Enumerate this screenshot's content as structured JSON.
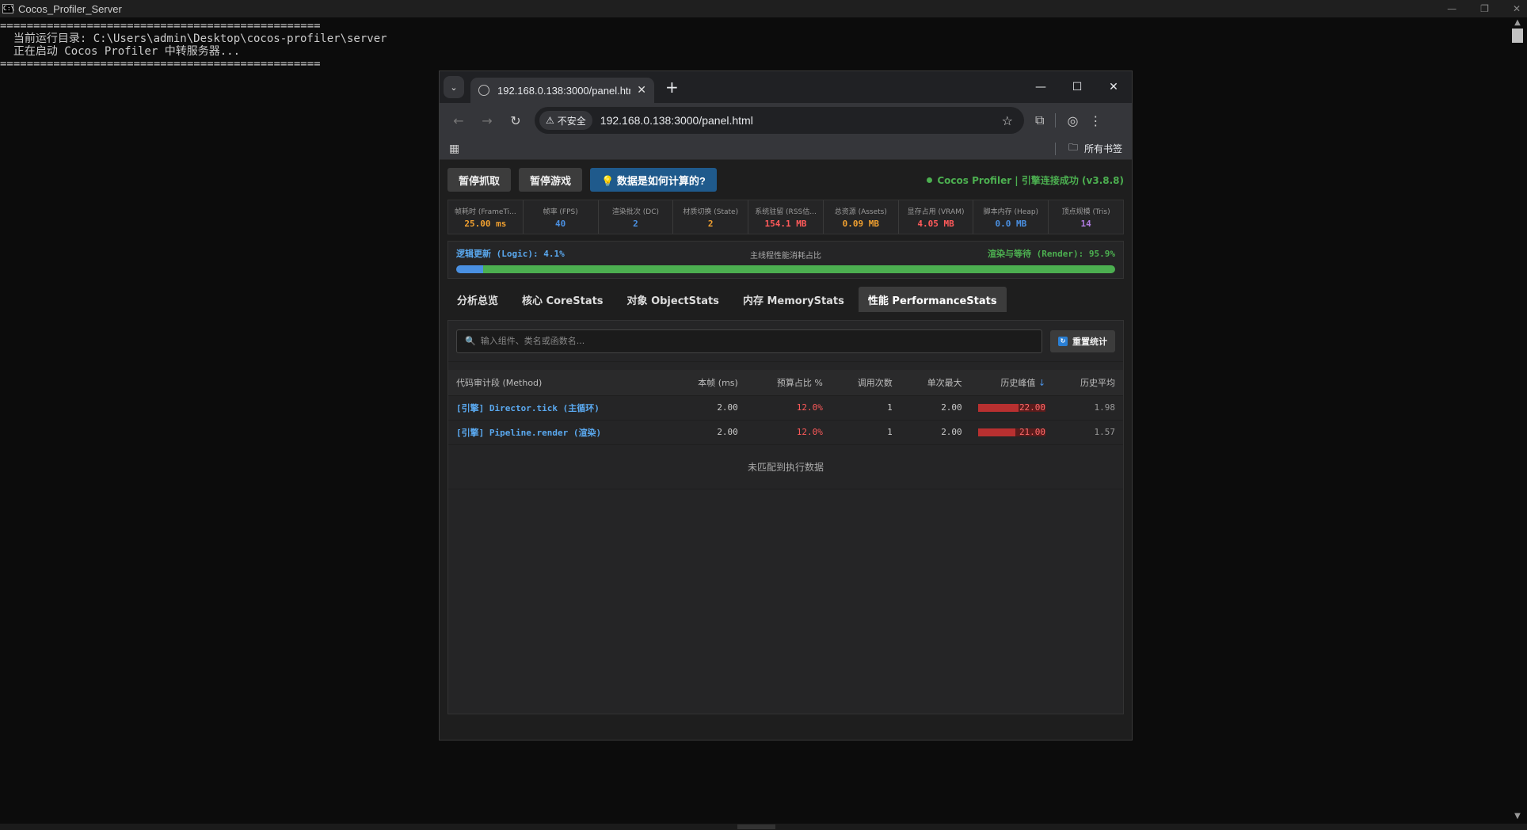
{
  "console": {
    "title": "Cocos_Profiler_Server",
    "lines": [
      "================================================",
      "  当前运行目录: C:\\Users\\admin\\Desktop\\cocos-profiler\\server",
      "  正在启动 Cocos Profiler 中转服务器...",
      "================================================"
    ]
  },
  "browser": {
    "tab_title": "192.168.0.138:3000/panel.html",
    "insecure_label": "不安全",
    "url": "192.168.0.138:3000/panel.html",
    "bookmarks_label": "所有书签"
  },
  "topbar": {
    "pause_capture": "暂停抓取",
    "pause_game": "暂停游戏",
    "how_calc": "💡 数据是如何计算的?",
    "status": "Cocos Profiler | 引擎连接成功 (v3.8.8)"
  },
  "stats": [
    {
      "label": "帧耗时 (FrameTi...",
      "value": "25.00 ms",
      "color": "#f0a030"
    },
    {
      "label": "帧率 (FPS)",
      "value": "40",
      "color": "#4a90e2"
    },
    {
      "label": "渲染批次 (DC)",
      "value": "2",
      "color": "#4a90e2"
    },
    {
      "label": "材质切换 (State)",
      "value": "2",
      "color": "#f0a030"
    },
    {
      "label": "系统驻留 (RSS估...",
      "value": "154.1 MB",
      "color": "#ff5a5a"
    },
    {
      "label": "总资源 (Assets)",
      "value": "0.09 MB",
      "color": "#f0a030"
    },
    {
      "label": "显存占用 (VRAM)",
      "value": "4.05 MB",
      "color": "#ff5a5a"
    },
    {
      "label": "脚本内存 (Heap)",
      "value": "0.0 MB",
      "color": "#4a90e2"
    },
    {
      "label": "顶点规模 (Tris)",
      "value": "14",
      "color": "#b07be0"
    }
  ],
  "budget": {
    "logic_label": "逻辑更新 (Logic): 4.1%",
    "middle_label": "主线程性能消耗占比",
    "render_label": "渲染与等待 (Render): 95.9%",
    "logic_pct": 4.1,
    "render_pct": 95.9
  },
  "tabs": [
    {
      "label": "分析总览",
      "active": false
    },
    {
      "label": "核心 CoreStats",
      "active": false
    },
    {
      "label": "对象 ObjectStats",
      "active": false
    },
    {
      "label": "内存 MemoryStats",
      "active": false
    },
    {
      "label": "性能 PerformanceStats",
      "active": true
    }
  ],
  "search": {
    "placeholder": "输入组件、类名或函数名...",
    "reset_label": "重置统计"
  },
  "table": {
    "headers": [
      "代码审计段 (Method)",
      "本帧 (ms)",
      "预算占比 %",
      "调用次数",
      "单次最大",
      "历史峰值",
      "历史平均"
    ],
    "sort_marker": "↓",
    "rows": [
      {
        "method": "[引擎] Director.tick (主循环)",
        "frame": "2.00",
        "ratio": "12.0%",
        "calls": "1",
        "max": "2.00",
        "peak": "22.00",
        "peak_frac": 0.6,
        "avg": "1.98"
      },
      {
        "method": "[引擎] Pipeline.render (渲染)",
        "frame": "2.00",
        "ratio": "12.0%",
        "calls": "1",
        "max": "2.00",
        "peak": "21.00",
        "peak_frac": 0.55,
        "avg": "1.57"
      }
    ],
    "empty_text": "未匹配到执行数据"
  }
}
